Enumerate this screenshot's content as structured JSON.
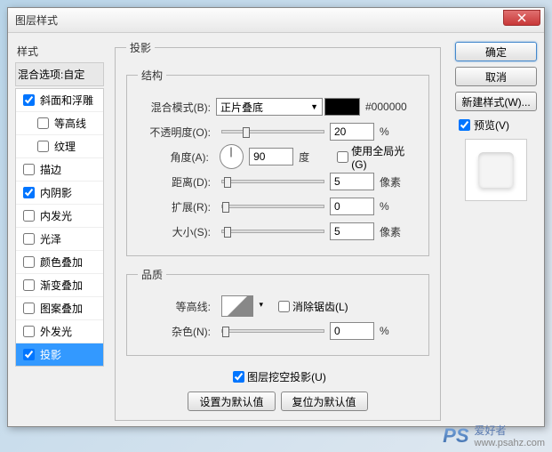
{
  "window": {
    "title": "图层样式"
  },
  "sidebar": {
    "header": "样式",
    "blend_options": "混合选项:自定",
    "items": [
      {
        "label": "斜面和浮雕",
        "checked": true,
        "indent": false
      },
      {
        "label": "等高线",
        "checked": false,
        "indent": true
      },
      {
        "label": "纹理",
        "checked": false,
        "indent": true
      },
      {
        "label": "描边",
        "checked": false,
        "indent": false
      },
      {
        "label": "内阴影",
        "checked": true,
        "indent": false
      },
      {
        "label": "内发光",
        "checked": false,
        "indent": false
      },
      {
        "label": "光泽",
        "checked": false,
        "indent": false
      },
      {
        "label": "颜色叠加",
        "checked": false,
        "indent": false
      },
      {
        "label": "渐变叠加",
        "checked": false,
        "indent": false
      },
      {
        "label": "图案叠加",
        "checked": false,
        "indent": false
      },
      {
        "label": "外发光",
        "checked": false,
        "indent": false
      },
      {
        "label": "投影",
        "checked": true,
        "indent": false,
        "selected": true
      }
    ]
  },
  "panel": {
    "title": "投影",
    "structure": {
      "legend": "结构",
      "blend_mode_label": "混合模式(B):",
      "blend_mode_value": "正片叠底",
      "color_hex": "#000000",
      "opacity_label": "不透明度(O):",
      "opacity_value": "20",
      "percent": "%",
      "angle_label": "角度(A):",
      "angle_value": "90",
      "angle_unit": "度",
      "global_light": "使用全局光(G)",
      "global_light_checked": false,
      "distance_label": "距离(D):",
      "distance_value": "5",
      "pixel": "像素",
      "spread_label": "扩展(R):",
      "spread_value": "0",
      "size_label": "大小(S):",
      "size_value": "5"
    },
    "quality": {
      "legend": "品质",
      "contour_label": "等高线:",
      "antialias": "消除锯齿(L)",
      "antialias_checked": false,
      "noise_label": "杂色(N):",
      "noise_value": "0",
      "percent": "%"
    },
    "knockout": "图层挖空投影(U)",
    "knockout_checked": true,
    "btn_default": "设置为默认值",
    "btn_reset": "复位为默认值"
  },
  "right": {
    "ok": "确定",
    "cancel": "取消",
    "new_style": "新建样式(W)...",
    "preview": "预览(V)",
    "preview_checked": true
  },
  "watermark": {
    "logo": "PS",
    "text": "爱好者",
    "url": "www.psahz.com"
  }
}
